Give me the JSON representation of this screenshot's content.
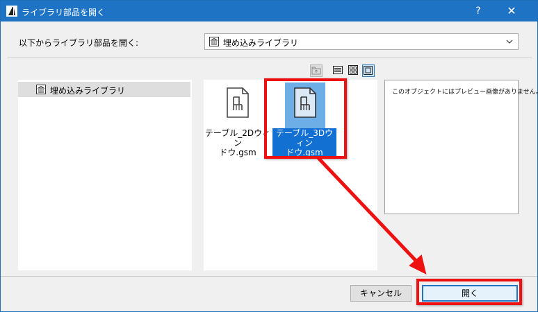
{
  "window": {
    "title": "ライブラリ部品を開く",
    "help_label": "?",
    "close_label": "✕",
    "app_icon": "archicad-logo-icon"
  },
  "header": {
    "prompt": "以下からライブラリ部品を開く:",
    "library_select": {
      "value": "埋め込みライブラリ",
      "icon": "library-icon"
    }
  },
  "toolbar": {
    "buttons": [
      {
        "icon": "folder-up-icon",
        "active": false
      },
      {
        "icon": "list-view-icon",
        "active": false
      },
      {
        "icon": "thumbnail-view-icon",
        "active": false
      },
      {
        "icon": "icon-view-icon",
        "active": true
      }
    ]
  },
  "tree": {
    "items": [
      {
        "label": "埋め込みライブラリ",
        "icon": "library-icon",
        "selected": true
      }
    ]
  },
  "files": [
    {
      "name": "テーブル_2Dウィンドウ.gsm",
      "line1": "テーブル_2Dウィン",
      "line2": "ドウ.gsm",
      "icon": "chair-object-icon",
      "selected": false
    },
    {
      "name": "テーブル_3Dウィンドウ.gsm",
      "line1": "テーブル_3Dウィン",
      "line2": "ドウ.gsm",
      "icon": "chair-object-icon",
      "selected": true
    }
  ],
  "preview": {
    "text": "このオブジェクトにはプレビュー画像がありません。"
  },
  "buttons": {
    "cancel": "キャンセル",
    "open": "開く"
  },
  "annotations": {
    "color": "#ee1111"
  }
}
